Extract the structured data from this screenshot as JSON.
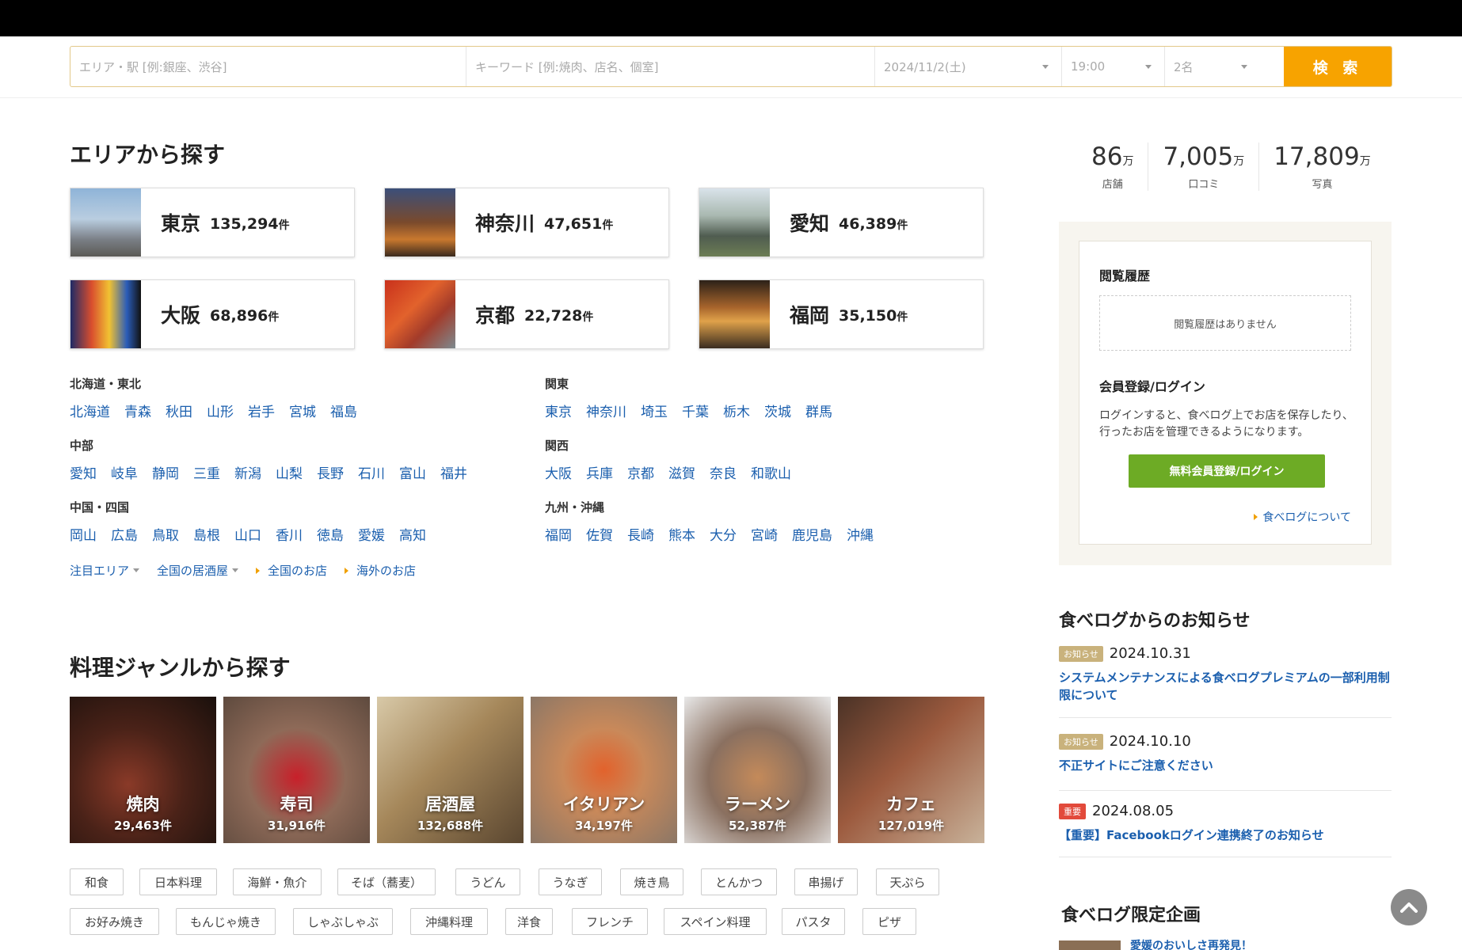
{
  "search": {
    "area_placeholder": "エリア・駅 [例:銀座、渋谷]",
    "keyword_placeholder": "キーワード [例:焼肉、店名、個室]",
    "date": "2024/11/2(土)",
    "time": "19:00",
    "people": "2名",
    "button": "検 索"
  },
  "area_section": {
    "title": "エリアから探す",
    "cards": [
      {
        "name": "東京",
        "count": "135,294",
        "unit": "件"
      },
      {
        "name": "神奈川",
        "count": "47,651",
        "unit": "件"
      },
      {
        "name": "愛知",
        "count": "46,389",
        "unit": "件"
      },
      {
        "name": "大阪",
        "count": "68,896",
        "unit": "件"
      },
      {
        "name": "京都",
        "count": "22,728",
        "unit": "件"
      },
      {
        "name": "福岡",
        "count": "35,150",
        "unit": "件"
      }
    ],
    "regions": [
      {
        "title": "北海道・東北",
        "links": [
          "北海道",
          "青森",
          "秋田",
          "山形",
          "岩手",
          "宮城",
          "福島"
        ]
      },
      {
        "title": "関東",
        "links": [
          "東京",
          "神奈川",
          "埼玉",
          "千葉",
          "栃木",
          "茨城",
          "群馬"
        ]
      },
      {
        "title": "中部",
        "links": [
          "愛知",
          "岐阜",
          "静岡",
          "三重",
          "新潟",
          "山梨",
          "長野",
          "石川",
          "富山",
          "福井"
        ]
      },
      {
        "title": "関西",
        "links": [
          "大阪",
          "兵庫",
          "京都",
          "滋賀",
          "奈良",
          "和歌山"
        ]
      },
      {
        "title": "中国・四国",
        "links": [
          "岡山",
          "広島",
          "鳥取",
          "島根",
          "山口",
          "香川",
          "徳島",
          "愛媛",
          "高知"
        ]
      },
      {
        "title": "九州・沖縄",
        "links": [
          "福岡",
          "佐賀",
          "長崎",
          "熊本",
          "大分",
          "宮崎",
          "鹿児島",
          "沖縄"
        ]
      }
    ],
    "more": [
      "注目エリア",
      "全国の居酒屋",
      "全国のお店",
      "海外のお店"
    ]
  },
  "genre_section": {
    "title": "料理ジャンルから探す",
    "genres": [
      {
        "name": "焼肉",
        "count": "29,463",
        "unit": "件"
      },
      {
        "name": "寿司",
        "count": "31,916",
        "unit": "件"
      },
      {
        "name": "居酒屋",
        "count": "132,688",
        "unit": "件"
      },
      {
        "name": "イタリアン",
        "count": "34,197",
        "unit": "件"
      },
      {
        "name": "ラーメン",
        "count": "52,387",
        "unit": "件"
      },
      {
        "name": "カフェ",
        "count": "127,019",
        "unit": "件"
      }
    ],
    "tags_row1": [
      "和食",
      "日本料理",
      "海鮮・魚介",
      "そば（蕎麦）",
      "うどん",
      "うなぎ",
      "焼き鳥",
      "とんかつ",
      "串揚げ",
      "天ぷら"
    ],
    "tags_row2": [
      "お好み焼き",
      "もんじゃ焼き",
      "しゃぶしゃぶ",
      "沖縄料理",
      "洋食",
      "フレンチ",
      "スペイン料理",
      "パスタ",
      "ピザ"
    ]
  },
  "stats": [
    {
      "num": "86",
      "unit": "万",
      "label": "店舗"
    },
    {
      "num": "7,005",
      "unit": "万",
      "label": "口コミ"
    },
    {
      "num": "17,809",
      "unit": "万",
      "label": "写真"
    }
  ],
  "sidebar": {
    "history_title": "閲覧履歴",
    "history_empty": "閲覧履歴はありません",
    "member_title": "会員登録/ログイン",
    "member_text": "ログインすると、食べログ上でお店を保存したり、行ったお店を管理できるようになります。",
    "login_button": "無料会員登録/ログイン",
    "about_link": "食べログについて"
  },
  "news": {
    "title": "食べログからのお知らせ",
    "items": [
      {
        "badge": "お知らせ",
        "badge_color": "#c9b27c",
        "date": "2024.10.31",
        "text": "システムメンテナンスによる食べログプレミアムの一部利用制限について"
      },
      {
        "badge": "お知らせ",
        "badge_color": "#c9b27c",
        "date": "2024.10.10",
        "text": "不正サイトにご注意ください"
      },
      {
        "badge": "重要",
        "badge_color": "#e24a3b",
        "date": "2024.08.05",
        "text": "【重要】Facebookログイン連携終了のお知らせ"
      }
    ]
  },
  "limited": {
    "title": "食べログ限定企画",
    "link": "愛媛のおいしさ再発見！"
  },
  "colors": {
    "accent": "#f7a300",
    "link": "#1b5fae",
    "login": "#6dab25"
  }
}
